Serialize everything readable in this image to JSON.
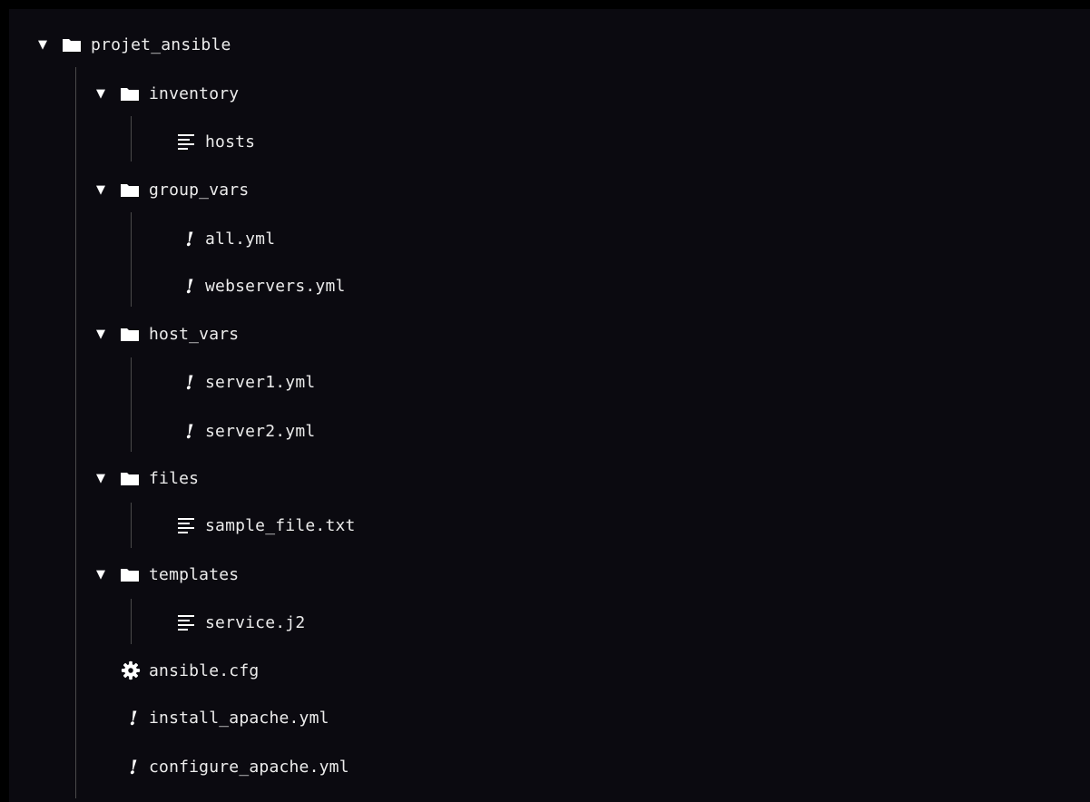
{
  "tree": {
    "root": {
      "label": "projet_ansible",
      "icon": "folder-icon",
      "expanded": true
    },
    "inventory": {
      "label": "inventory",
      "icon": "folder-icon",
      "expanded": true
    },
    "hosts": {
      "label": "hosts",
      "icon": "text-lines-icon"
    },
    "group_vars": {
      "label": "group_vars",
      "icon": "folder-icon",
      "expanded": true
    },
    "all_yml": {
      "label": "all.yml",
      "icon": "yaml-exclamation-icon"
    },
    "webservers_yml": {
      "label": "webservers.yml",
      "icon": "yaml-exclamation-icon"
    },
    "host_vars": {
      "label": "host_vars",
      "icon": "folder-icon",
      "expanded": true
    },
    "server1_yml": {
      "label": "server1.yml",
      "icon": "yaml-exclamation-icon"
    },
    "server2_yml": {
      "label": "server2.yml",
      "icon": "yaml-exclamation-icon"
    },
    "files": {
      "label": "files",
      "icon": "folder-icon",
      "expanded": true
    },
    "sample_file": {
      "label": "sample_file.txt",
      "icon": "text-lines-icon"
    },
    "templates": {
      "label": "templates",
      "icon": "folder-icon",
      "expanded": true
    },
    "service_j2": {
      "label": "service.j2",
      "icon": "text-lines-icon"
    },
    "ansible_cfg": {
      "label": "ansible.cfg",
      "icon": "gear-icon"
    },
    "install_apache": {
      "label": "install_apache.yml",
      "icon": "yaml-exclamation-icon"
    },
    "configure_apache": {
      "label": "configure_apache.yml",
      "icon": "yaml-exclamation-icon"
    }
  },
  "colors": {
    "background": "#0b0a10",
    "text": "#ececec",
    "guide": "#4a4a4a"
  }
}
